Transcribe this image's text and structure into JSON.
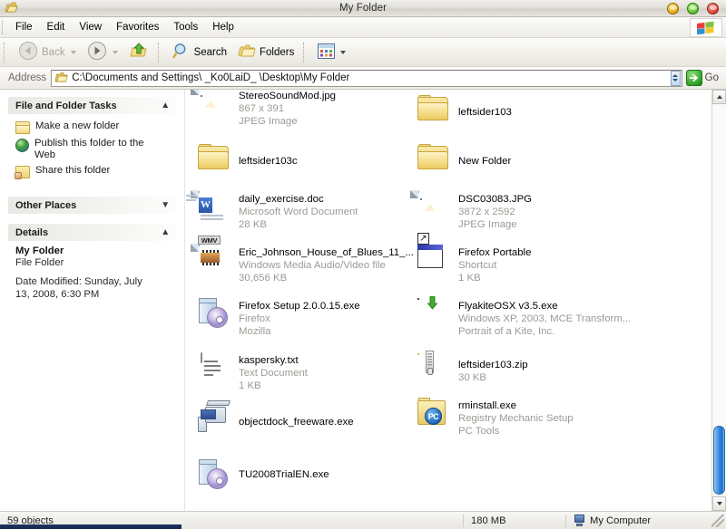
{
  "window": {
    "title": "My Folder",
    "buttons": {
      "minimize": "minimize",
      "maximize": "maximize",
      "close": "close"
    }
  },
  "menubar": {
    "items": [
      "File",
      "Edit",
      "View",
      "Favorites",
      "Tools",
      "Help"
    ]
  },
  "toolbar": {
    "back_label": "Back",
    "forward_label": "Forward",
    "up_label": "Up",
    "search_label": "Search",
    "folders_label": "Folders",
    "views_label": "Views"
  },
  "address": {
    "label": "Address",
    "path": "C:\\Documents and Settings\\ _Ko0LaiD_ \\Desktop\\My Folder",
    "go_label": "Go"
  },
  "sidebar": {
    "panels": [
      {
        "title": "File and Folder Tasks",
        "collapse_state": "expanded",
        "tasks": [
          {
            "label": "Make a new folder",
            "icon": "new-folder-icon"
          },
          {
            "label": "Publish this folder to the Web",
            "icon": "globe-icon"
          },
          {
            "label": "Share this folder",
            "icon": "share-folder-icon"
          }
        ]
      },
      {
        "title": "Other Places",
        "collapse_state": "collapsed",
        "tasks": []
      },
      {
        "title": "Details",
        "collapse_state": "expanded",
        "detail_name": "My Folder",
        "detail_type": "File Folder",
        "detail_date": "Date Modified: Sunday, July 13, 2008, 6:30 PM"
      }
    ]
  },
  "files": {
    "left_column": [
      {
        "name": "StereoSoundMod.jpg",
        "line2": "867 x 391",
        "line3": "JPEG Image",
        "icon": "jpeg-image-icon"
      },
      {
        "name": "leftsider103c",
        "line2": "",
        "line3": "",
        "icon": "folder-icon"
      },
      {
        "name": "daily_exercise.doc",
        "line2": "Microsoft Word Document",
        "line3": "28 KB",
        "icon": "word-document-icon"
      },
      {
        "name": "Eric_Johnson_House_of_Blues_11_...",
        "line2": "Windows Media Audio/Video file",
        "line3": "30,656 KB",
        "icon": "wmv-video-icon"
      },
      {
        "name": "Firefox Setup 2.0.0.15.exe",
        "line2": "Firefox",
        "line3": "Mozilla",
        "icon": "setup-installer-icon"
      },
      {
        "name": "kaspersky.txt",
        "line2": "Text Document",
        "line3": "1 KB",
        "icon": "text-document-icon"
      },
      {
        "name": "objectdock_freeware.exe",
        "line2": "",
        "line3": "",
        "icon": "application-computer-icon"
      },
      {
        "name": "TU2008TrialEN.exe",
        "line2": "",
        "line3": "",
        "icon": "setup-installer-icon"
      }
    ],
    "right_column": [
      {
        "name": "leftsider103",
        "line2": "",
        "line3": "",
        "icon": "folder-icon"
      },
      {
        "name": "New Folder",
        "line2": "",
        "line3": "",
        "icon": "folder-icon"
      },
      {
        "name": "DSC03083.JPG",
        "line2": "3872 x 2592",
        "line3": "JPEG Image",
        "icon": "jpeg-image-icon"
      },
      {
        "name": "Firefox Portable",
        "line2": "Shortcut",
        "line3": "1 KB",
        "icon": "shortcut-icon"
      },
      {
        "name": "FlyakiteOSX v3.5.exe",
        "line2": "Windows XP, 2003, MCE Transform...",
        "line3": "Portrait of a Kite, Inc.",
        "icon": "flyakite-icon"
      },
      {
        "name": "leftsider103.zip",
        "line2": "30 KB",
        "line3": "",
        "icon": "zip-folder-icon"
      },
      {
        "name": "rminstall.exe",
        "line2": "Registry Mechanic Setup",
        "line3": "PC Tools",
        "icon": "pc-tools-icon"
      }
    ]
  },
  "statusbar": {
    "objects": "59 objects",
    "size": "180 MB",
    "location": "My Computer"
  },
  "colors": {
    "accent_blue": "#2f86de",
    "folder_yellow": "#eccb62",
    "close_red": "#d94034",
    "maximize_green": "#57bd2d",
    "minimize_yellow": "#e3a614"
  }
}
